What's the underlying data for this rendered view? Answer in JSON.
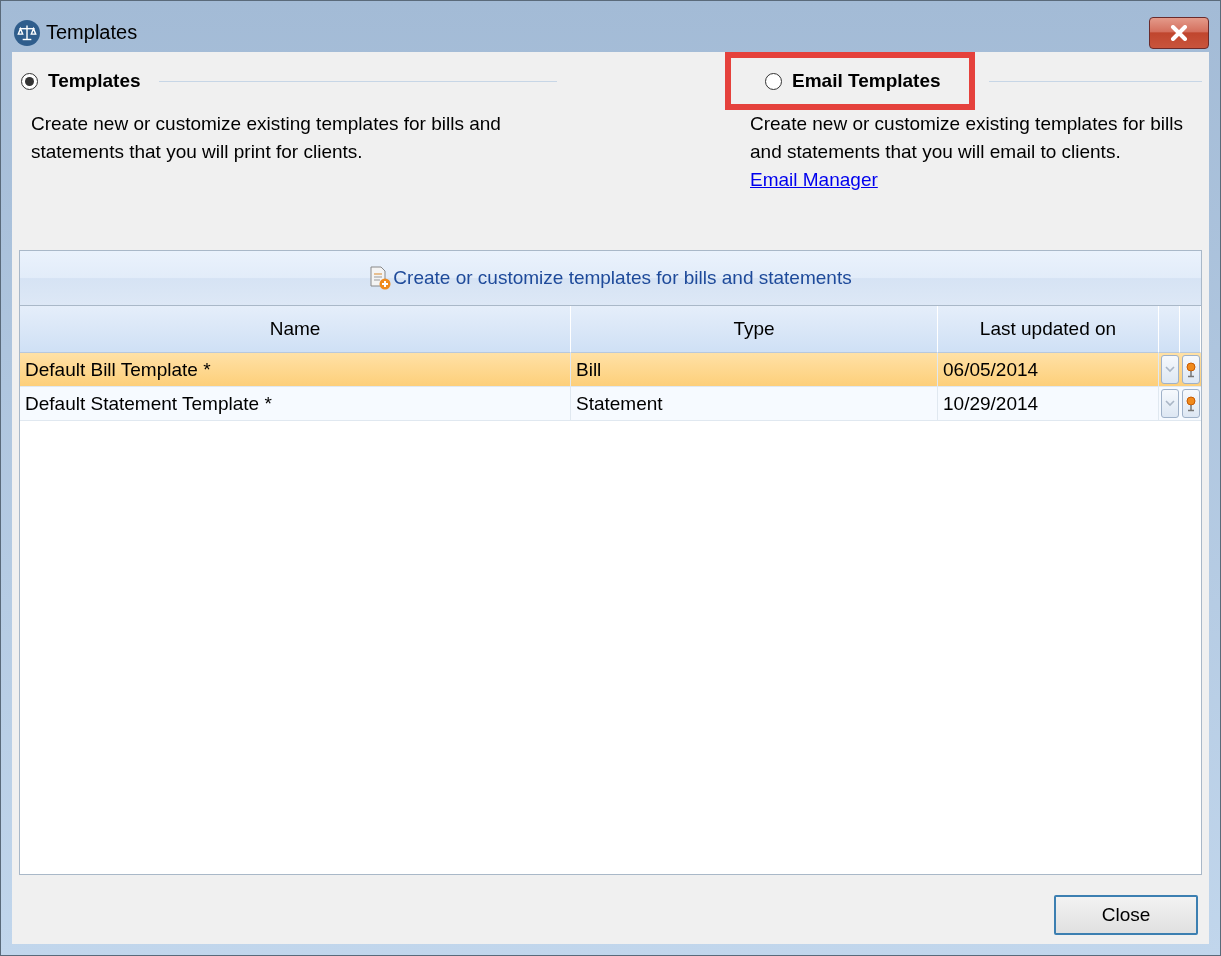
{
  "window": {
    "title": "Templates"
  },
  "options": [
    {
      "label": "Templates",
      "selected": true,
      "highlighted": false,
      "description": "Create new or customize existing templates for bills and statements that you will print for clients."
    },
    {
      "label": "Email Templates",
      "selected": false,
      "highlighted": true,
      "description": "Create new or customize existing templates for bills and statements that you will email to clients.",
      "link": "Email Manager"
    }
  ],
  "toolbar": {
    "label": "Create or customize templates for bills and statements"
  },
  "table": {
    "columns": [
      "Name",
      "Type",
      "Last updated on"
    ],
    "rows": [
      {
        "cells": [
          "Default Bill Template *",
          "Bill",
          "06/05/2014"
        ],
        "selected": true
      },
      {
        "cells": [
          "Default Statement Template *",
          "Statement",
          "10/29/2014"
        ],
        "selected": false
      }
    ]
  },
  "buttons": [
    "Close"
  ]
}
